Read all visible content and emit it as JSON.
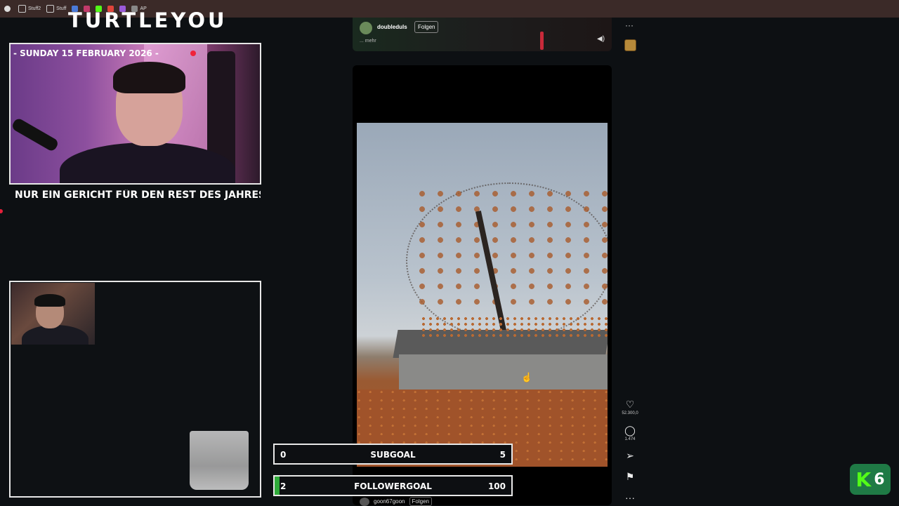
{
  "browser": {
    "bookmarks": [
      {
        "icon": "chrome-icon",
        "label": ""
      },
      {
        "icon": "folder-icon",
        "label": "Stuff2"
      },
      {
        "icon": "folder-icon",
        "label": "Stuff"
      },
      {
        "icon": "site-icon",
        "label": ""
      },
      {
        "icon": "site-icon",
        "label": ""
      },
      {
        "icon": "site-icon",
        "label": ""
      },
      {
        "icon": "site-icon",
        "label": ""
      },
      {
        "icon": "site-icon",
        "label": ""
      },
      {
        "icon": "site-icon",
        "label": "AP"
      }
    ]
  },
  "overlay": {
    "channel_title": "TURTLEYOU",
    "date_text": "- SUNDAY 15 FEBRUARY 2026 -",
    "ticker_text": "NUR EIN GERICHT FÜR DEN REST DES JAHRES ESSEN DÜRFTET - WEI",
    "subgoal": {
      "min": "0",
      "label": "SUBGOAL",
      "max": "5",
      "progress": 0
    },
    "followergoal": {
      "min": "2",
      "label": "FOLLOWERGOAL",
      "max": "100",
      "progress": 0.02
    },
    "kick_badge": {
      "letter": "K",
      "number": "6"
    }
  },
  "feed": {
    "top_post": {
      "username": "doubleduls",
      "follow_label": "Folgen",
      "more_label": "... mehr"
    },
    "actions": {
      "like_count": "52.300,0",
      "comment_count": "1.474"
    },
    "next_post": {
      "username": "goon67goon",
      "follow_label": "Folgen"
    },
    "colors": {
      "accent_green": "#53fc18",
      "live_red": "#f0233a"
    }
  }
}
